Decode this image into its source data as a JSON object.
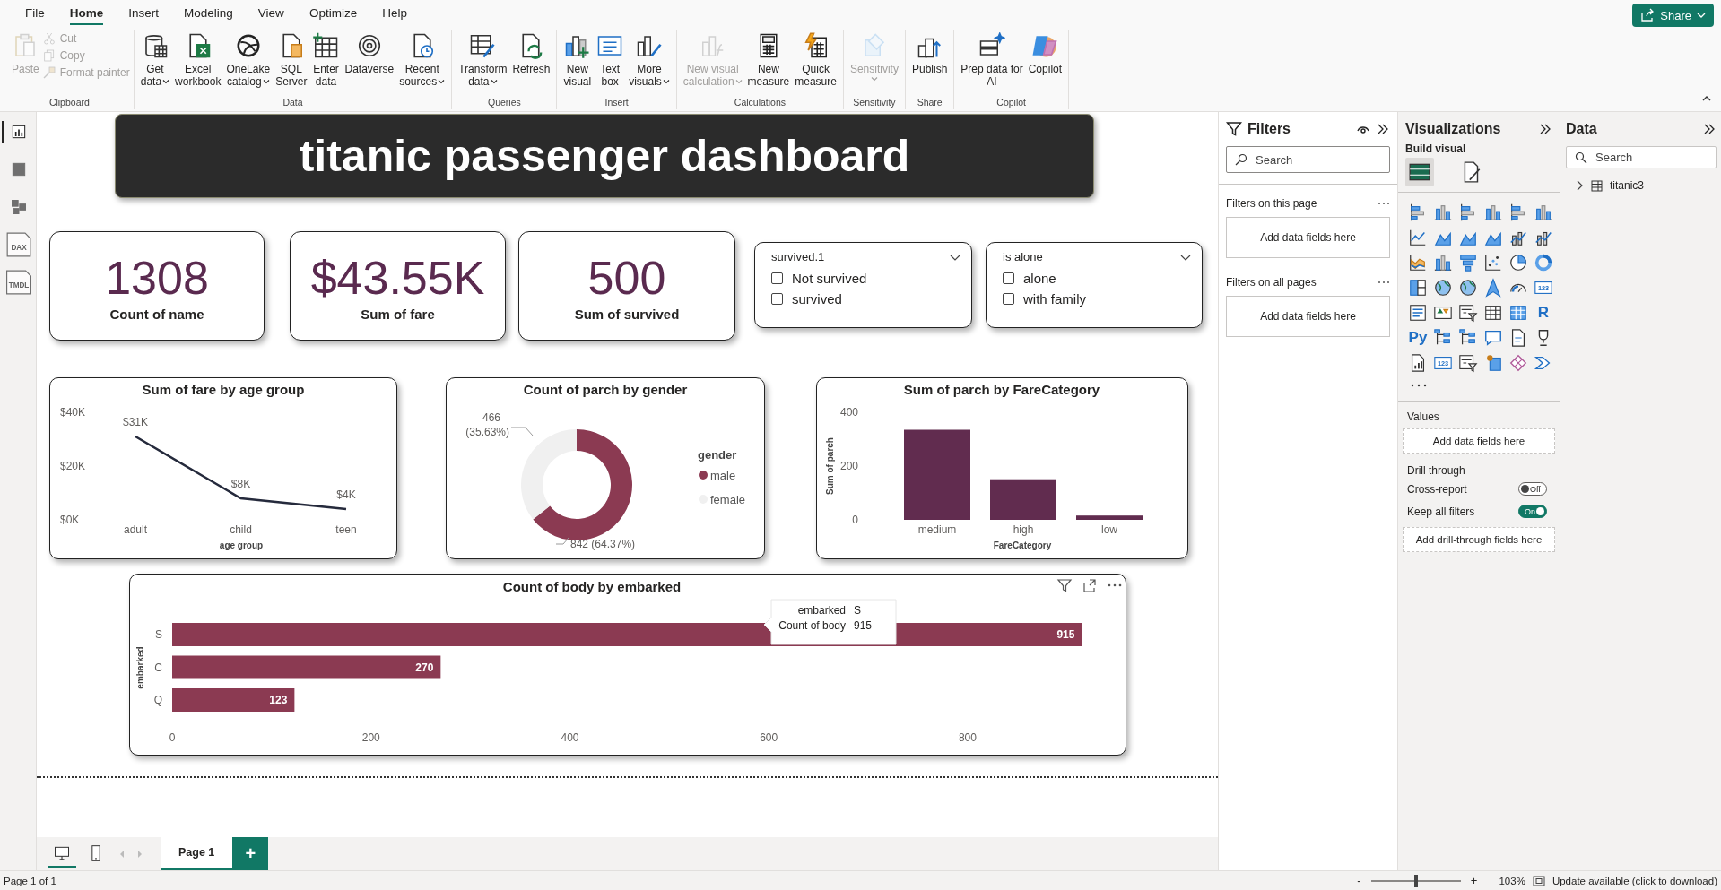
{
  "menu_tabs": [
    {
      "label": "File",
      "selected": false
    },
    {
      "label": "Home",
      "selected": true
    },
    {
      "label": "Insert",
      "selected": false
    },
    {
      "label": "Modeling",
      "selected": false
    },
    {
      "label": "View",
      "selected": false
    },
    {
      "label": "Optimize",
      "selected": false
    },
    {
      "label": "Help",
      "selected": false
    }
  ],
  "share_button": {
    "label": "Share"
  },
  "ribbon_groups": [
    {
      "label": "Clipboard",
      "buttons": [
        {
          "kind": "large",
          "lines": [
            "Paste"
          ],
          "caret": false,
          "disabled": true
        },
        {
          "kind": "small",
          "lines": [
            "Cut"
          ],
          "caret": false,
          "disabled": true
        },
        {
          "kind": "small",
          "lines": [
            "Copy"
          ],
          "caret": false,
          "disabled": true
        },
        {
          "kind": "small",
          "lines": [
            "Format painter"
          ],
          "caret": false,
          "disabled": true
        }
      ]
    },
    {
      "label": "Data",
      "buttons": [
        {
          "kind": "large",
          "lines": [
            "Get",
            "data"
          ],
          "caret": true,
          "disabled": false
        },
        {
          "kind": "large",
          "lines": [
            "Excel",
            "workbook"
          ],
          "caret": false,
          "disabled": false
        },
        {
          "kind": "large",
          "lines": [
            "OneLake",
            "catalog"
          ],
          "caret": true,
          "disabled": false
        },
        {
          "kind": "large",
          "lines": [
            "SQL",
            "Server"
          ],
          "caret": false,
          "disabled": false
        },
        {
          "kind": "large",
          "lines": [
            "Enter",
            "data"
          ],
          "caret": false,
          "disabled": false
        },
        {
          "kind": "large",
          "lines": [
            "Dataverse"
          ],
          "caret": false,
          "disabled": false
        },
        {
          "kind": "large",
          "lines": [
            "Recent",
            "sources"
          ],
          "caret": true,
          "disabled": false
        }
      ]
    },
    {
      "label": "Queries",
      "buttons": [
        {
          "kind": "large",
          "lines": [
            "Transform",
            "data"
          ],
          "caret": true,
          "disabled": false
        },
        {
          "kind": "large",
          "lines": [
            "Refresh"
          ],
          "caret": false,
          "disabled": false
        }
      ]
    },
    {
      "label": "Insert",
      "buttons": [
        {
          "kind": "large",
          "lines": [
            "New",
            "visual"
          ],
          "caret": false,
          "disabled": false
        },
        {
          "kind": "large",
          "lines": [
            "Text",
            "box"
          ],
          "caret": false,
          "disabled": false
        },
        {
          "kind": "large",
          "lines": [
            "More",
            "visuals"
          ],
          "caret": true,
          "disabled": false
        }
      ]
    },
    {
      "label": "Calculations",
      "buttons": [
        {
          "kind": "large",
          "lines": [
            "New visual",
            "calculation"
          ],
          "caret": true,
          "disabled": true
        },
        {
          "kind": "large",
          "lines": [
            "New",
            "measure"
          ],
          "caret": false,
          "disabled": false
        },
        {
          "kind": "large",
          "lines": [
            "Quick",
            "measure"
          ],
          "caret": false,
          "disabled": false
        }
      ]
    },
    {
      "label": "Sensitivity",
      "buttons": [
        {
          "kind": "menu",
          "lines": [
            "Sensitivity"
          ],
          "caret": true,
          "disabled": true
        }
      ]
    },
    {
      "label": "Share",
      "buttons": [
        {
          "kind": "large",
          "lines": [
            "Publish"
          ],
          "caret": false,
          "disabled": false
        }
      ]
    },
    {
      "label": "Copilot",
      "buttons": [
        {
          "kind": "large",
          "lines": [
            "Prep data for",
            "AI"
          ],
          "caret": false,
          "disabled": false
        },
        {
          "kind": "large",
          "lines": [
            "Copilot"
          ],
          "caret": false,
          "disabled": false
        }
      ]
    }
  ],
  "rail": [
    {
      "kind": "report",
      "selected": true
    },
    {
      "kind": "table",
      "selected": false
    },
    {
      "kind": "model",
      "selected": false
    },
    {
      "kind": "dax",
      "text": "DAX",
      "selected": false
    },
    {
      "kind": "tmdl",
      "text": "TMDL",
      "selected": false
    }
  ],
  "report_title": "titanic passenger dashboard",
  "cards": [
    {
      "value": "1308",
      "label": "Count of name"
    },
    {
      "value": "$43.55K",
      "label": "Sum of fare"
    },
    {
      "value": "500",
      "label": "Sum of survived"
    }
  ],
  "slicers": [
    {
      "title": "survived.1",
      "items": [
        {
          "label": "Not survived",
          "checked": false
        },
        {
          "label": "survived",
          "checked": false
        }
      ]
    },
    {
      "title": "is alone",
      "items": [
        {
          "label": "alone",
          "checked": false
        },
        {
          "label": "with family",
          "checked": false
        }
      ]
    }
  ],
  "visuals": [
    {
      "chart_data": {
        "type": "line",
        "title": "Sum of fare by age group",
        "xlabel": "age group",
        "categories": [
          "adult",
          "child",
          "teen"
        ],
        "series": [
          {
            "color": "#252a3c",
            "values": [
              31000,
              8000,
              4000
            ]
          }
        ],
        "ylim": [
          0,
          40000
        ],
        "yticks": [
          {
            "value": 0,
            "label": "$0K"
          },
          {
            "value": 20000,
            "label": "$20K"
          },
          {
            "value": 40000,
            "label": "$40K"
          }
        ],
        "value_labels": [
          "$31K",
          "$8K",
          "$4K"
        ]
      }
    },
    {
      "slices": [
        {
          "color": "#8b3a52"
        },
        {
          "color": "#f0f0f0"
        }
      ],
      "chart_data": {
        "type": "donut",
        "title": "Count of parch by gender",
        "categories": [
          "male",
          "female"
        ],
        "series": [
          {
            "values": [
              64.37,
              35.63
            ]
          }
        ],
        "value_labels": [
          "842 (64.37%)",
          "466 (35.63%)"
        ],
        "legend": {
          "title": "gender"
        }
      }
    },
    {
      "chart_data": {
        "type": "bar",
        "title": "Sum of parch by FareCategory",
        "xlabel": "FareCategory",
        "ylabel": "Sum of parch",
        "categories": [
          "medium",
          "high",
          "low"
        ],
        "series": [
          {
            "color": "#612c4f",
            "values": [
              335,
              151,
              16
            ]
          }
        ],
        "ylim": [
          0,
          400
        ],
        "yticks": [
          0,
          200,
          400
        ]
      }
    }
  ],
  "bar_visual": {
    "chart_data": {
      "type": "bar",
      "orientation": "horizontal",
      "title": "Count of body by embarked",
      "ylabel": "embarked",
      "categories": [
        "S",
        "C",
        "Q"
      ],
      "series": [
        {
          "color": "#8b3a52",
          "values": [
            915,
            270,
            123
          ]
        }
      ],
      "xlim": [
        0,
        920
      ],
      "xticks": [
        0,
        200,
        400,
        600,
        800
      ],
      "data_labels": true
    },
    "tooltip": [
      {
        "label": "embarked",
        "value": "S"
      },
      {
        "label": "Count of body",
        "value": "915"
      }
    ]
  },
  "pages": [
    {
      "label": "Page 1",
      "selected": true
    }
  ],
  "add_page": "+",
  "views": [
    {
      "kind": "desktop",
      "selected": true
    },
    {
      "kind": "phone",
      "selected": false
    }
  ],
  "filters": {
    "title": "Filters",
    "search_placeholder": "Search",
    "sections": [
      {
        "label": "Filters on this page",
        "drop": "Add data fields here"
      },
      {
        "label": "Filters on all pages",
        "drop": "Add data fields here"
      }
    ]
  },
  "visualizations": {
    "title": "Visualizations",
    "subtitle": "Build visual",
    "build_tabs": [
      {
        "kind": "fields",
        "selected": true
      },
      {
        "kind": "format",
        "selected": false
      }
    ],
    "gallery": [
      {
        "kind": "hbar"
      },
      {
        "kind": "column"
      },
      {
        "kind": "hbar"
      },
      {
        "kind": "column"
      },
      {
        "kind": "hbar"
      },
      {
        "kind": "column"
      },
      {
        "kind": "line"
      },
      {
        "kind": "area"
      },
      {
        "kind": "area"
      },
      {
        "kind": "area"
      },
      {
        "kind": "combo"
      },
      {
        "kind": "combo"
      },
      {
        "kind": "ribbon"
      },
      {
        "kind": "column"
      },
      {
        "kind": "funnel"
      },
      {
        "kind": "scatter"
      },
      {
        "kind": "pie"
      },
      {
        "kind": "donut"
      },
      {
        "kind": "treemap"
      },
      {
        "kind": "map"
      },
      {
        "kind": "map"
      },
      {
        "kind": "arrow"
      },
      {
        "kind": "gauge"
      },
      {
        "kind": "card",
        "text": "123"
      },
      {
        "kind": "text"
      },
      {
        "kind": "kpi"
      },
      {
        "kind": "slicer"
      },
      {
        "kind": "table"
      },
      {
        "kind": "matrix"
      },
      {
        "kind": "glyph",
        "text": "R"
      },
      {
        "kind": "glyph",
        "text": "Py"
      },
      {
        "kind": "tree"
      },
      {
        "kind": "tree"
      },
      {
        "kind": "bubble"
      },
      {
        "kind": "doc"
      },
      {
        "kind": "trophy"
      },
      {
        "kind": "report"
      },
      {
        "kind": "card",
        "text": "123"
      },
      {
        "kind": "slicer"
      },
      {
        "kind": "pinmap"
      },
      {
        "kind": "diamond"
      },
      {
        "kind": "chevron"
      }
    ],
    "values_label": "Values",
    "values_drop": "Add data fields here",
    "drill_title": "Drill through",
    "toggles": [
      {
        "label": "Cross-report",
        "on": false,
        "text": "Off"
      },
      {
        "label": "Keep all filters",
        "on": true,
        "text": "On"
      }
    ],
    "drill_drop": "Add drill-through fields here"
  },
  "data_pane": {
    "title": "Data",
    "search_placeholder": "Search",
    "tables": [
      {
        "name": "titanic3",
        "expanded": false
      }
    ]
  },
  "status": {
    "page_info": "Page 1 of 1",
    "zoom": {
      "minus": "-",
      "plus": "+",
      "level": 0.5,
      "reading": "103%"
    },
    "update": "Update available (click to download)"
  }
}
